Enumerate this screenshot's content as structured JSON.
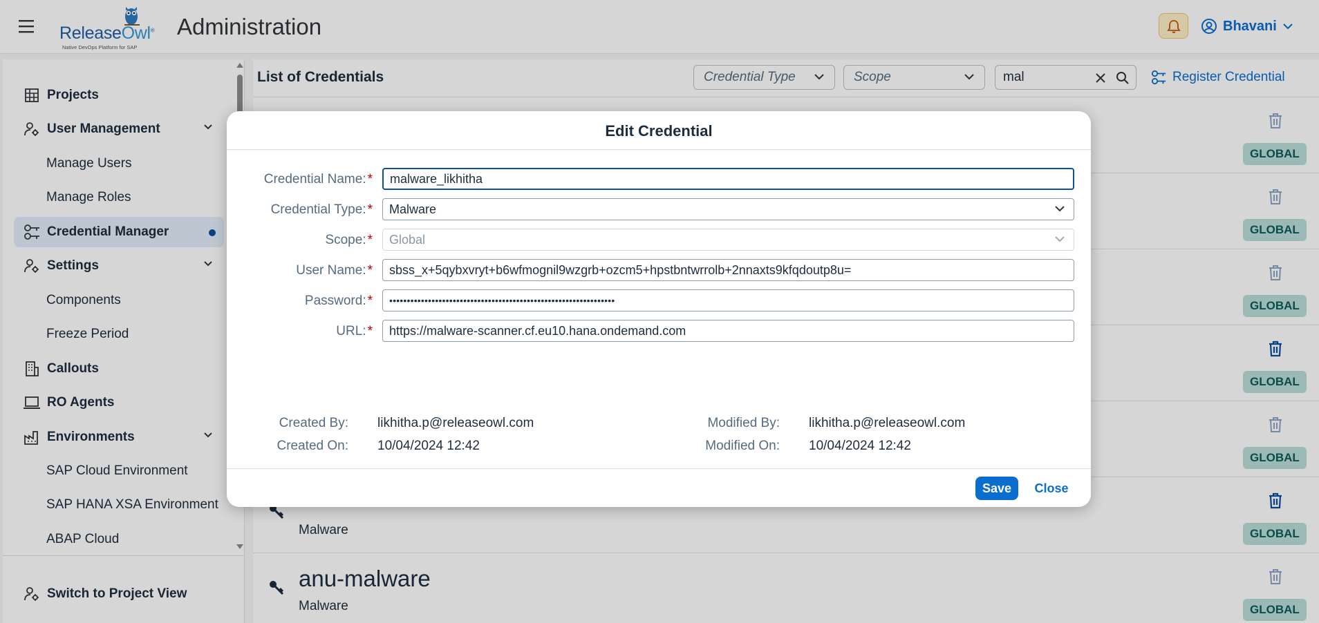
{
  "header": {
    "logo_text_a": "Release",
    "logo_text_b": "Owl",
    "logo_sub": "Native DevOps Platform for SAP",
    "title": "Administration",
    "user": "Bhavani",
    "accent": "#0a6ed1"
  },
  "sidebar": {
    "items": [
      {
        "label": "Projects"
      },
      {
        "label": "User Management"
      },
      {
        "label": "Manage Users"
      },
      {
        "label": "Manage Roles"
      },
      {
        "label": "Credential Manager"
      },
      {
        "label": "Settings"
      },
      {
        "label": "Components"
      },
      {
        "label": "Freeze Period"
      },
      {
        "label": "Callouts"
      },
      {
        "label": "RO Agents"
      },
      {
        "label": "Environments"
      },
      {
        "label": "SAP Cloud Environment"
      },
      {
        "label": "SAP HANA XSA Environment"
      },
      {
        "label": "ABAP Cloud"
      }
    ],
    "footer_label": "Switch to Project View"
  },
  "main": {
    "title": "List of Credentials",
    "filter_type_placeholder": "Credential Type",
    "filter_scope_placeholder": "Scope",
    "search_value": "mal",
    "register_label": "Register Credential",
    "rows": [
      {
        "name": "",
        "type": "",
        "scope": "GLOBAL"
      },
      {
        "name": "",
        "type": "",
        "scope": "GLOBAL"
      },
      {
        "name": "",
        "type": "",
        "scope": "GLOBAL"
      },
      {
        "name": "",
        "type": "",
        "scope": "GLOBAL"
      },
      {
        "name": "",
        "type": "",
        "scope": "GLOBAL"
      },
      {
        "name": "",
        "type": "Malware",
        "scope": "GLOBAL"
      },
      {
        "name": "anu-malware",
        "type": "Malware",
        "scope": "GLOBAL"
      }
    ]
  },
  "dialog": {
    "title": "Edit Credential",
    "fields": {
      "name_label": "Credential Name:",
      "name_value": "malware_likhitha",
      "type_label": "Credential Type:",
      "type_value": "Malware",
      "scope_label": "Scope:",
      "scope_value": "Global",
      "user_label": "User Name:",
      "user_value": "sbss_x+5qybxvryt+b6wfmognil9wzgrb+ozcm5+hpstbntwrrolb+2nnaxts9kfqdoutp8u=",
      "password_label": "Password:",
      "password_value": "••••••••••••••••••••••••••••••••••••••••••••••••••••••••••••••••",
      "url_label": "URL:",
      "url_value": "https://malware-scanner.cf.eu10.hana.ondemand.com",
      "required_mark": "*"
    },
    "meta": {
      "created_by_label": "Created By:",
      "created_by": "likhitha.p@releaseowl.com",
      "created_on_label": "Created On:",
      "created_on": "10/04/2024 12:42",
      "modified_by_label": "Modified By:",
      "modified_by": "likhitha.p@releaseowl.com",
      "modified_on_label": "Modified On:",
      "modified_on": "10/04/2024 12:42"
    },
    "save_label": "Save",
    "close_label": "Close"
  }
}
